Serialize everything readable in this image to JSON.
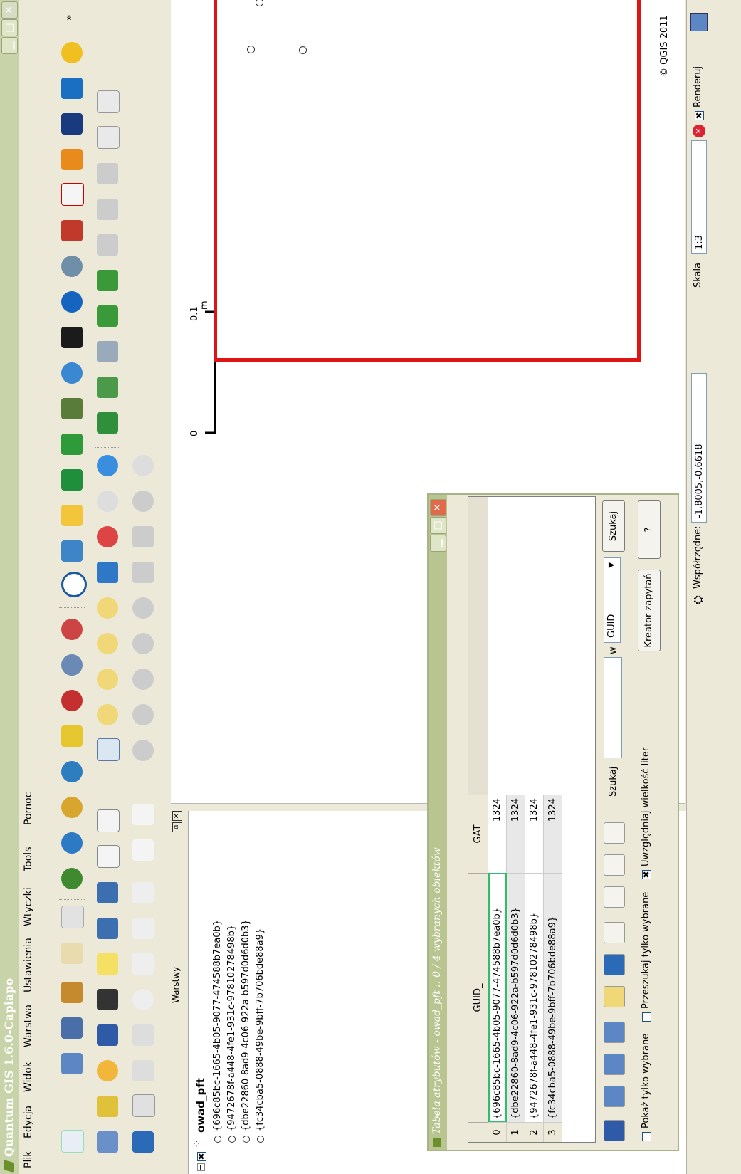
{
  "window": {
    "title": "Quantum GIS 1.6.0-Capiapo"
  },
  "menu": [
    "Plik",
    "Edycja",
    "Widok",
    "Warstwa",
    "Ustawienia",
    "Wtyczki",
    "Tools",
    "Pomoc"
  ],
  "layers_panel": {
    "header": "Warstwy",
    "layer_name": "owad_pft",
    "features": [
      "{696c85bc-1665-4b05-9077-474588b7ea0b}",
      "{9472678f-a448-4fe1-931c-97810278498b}",
      "{dbe22860-8ad9-4c06-922a-b597d0d6d0b3}",
      "{fc34cba5-0888-49be-9bff-7b706bde88a9}"
    ]
  },
  "scalebar": {
    "start": "0",
    "end": "0.1",
    "unit": "m"
  },
  "canvas": {
    "copyright": "© QGIS 2011"
  },
  "status": {
    "coords_label": "Współrzędne:",
    "coords_value": "-1.8005,-0.6618",
    "scale_label": "Skala",
    "scale_value": "1:3",
    "render_label": "Renderuj"
  },
  "attr_dialog": {
    "title": "Tabela atrybutów - owad_pft :: 0 / 4 wybranych obiektów",
    "columns": [
      "GUID_",
      "GAT"
    ],
    "rows": [
      {
        "idx": "0",
        "guid": "{696c85bc-1665-4b05-9077-474588b7ea0b}",
        "gat": "1324"
      },
      {
        "idx": "1",
        "guid": "{dbe22860-8ad9-4c06-922a-b597d0d6d0b3}",
        "gat": "1324"
      },
      {
        "idx": "2",
        "guid": "{9472678f-a448-4fe1-931c-97810278498b}",
        "gat": "1324"
      },
      {
        "idx": "3",
        "guid": "{fc34cba5-0888-49be-9bff-7b706bde88a9}",
        "gat": "1324"
      }
    ],
    "show_selected": "Pokaż tylko wybrane",
    "search_selected": "Przeszukaj tylko wybrane",
    "case_sensitive": "Uwzględniaj wielkość liter",
    "search_label": "Szukaj",
    "in_label": "w",
    "field_select": "GUID_",
    "search_button": "Szukaj",
    "query_builder": "Kreator zapytań",
    "help_button": "?"
  },
  "colors": {
    "extent_red": "#e01414",
    "title_green": "#c9d3a9"
  }
}
